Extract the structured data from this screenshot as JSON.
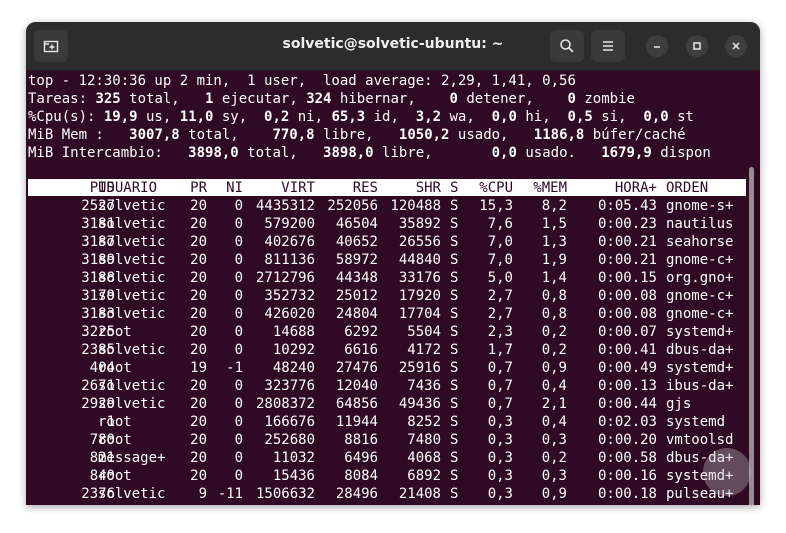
{
  "window": {
    "title": "solvetic@solvetic-ubuntu: ~",
    "icons": {
      "new_tab": "new-tab-icon",
      "search": "search-icon",
      "menu": "hamburger-menu-icon",
      "minimize": "minimize-icon",
      "maximize": "maximize-icon",
      "close": "close-icon"
    }
  },
  "summary": {
    "l1": {
      "a": "top - 12:30:36 up 2 min,  1 user,  load average: 2,29, 1,41, 0,56"
    },
    "l2": {
      "a": "Tareas: ",
      "v1": "325",
      "b": " total,   ",
      "v2": "1",
      "c": " ejecutar, ",
      "v3": "324",
      "d": " hibernar,    ",
      "v4": "0",
      "e": " detener,    ",
      "v5": "0",
      "f": " zombie"
    },
    "l3": {
      "a": "%Cpu(s): ",
      "v1": "19,9",
      "b": " us, ",
      "v2": "11,0",
      "c": " sy,  ",
      "v3": "0,2",
      "d": " ni, ",
      "v4": "65,3",
      "e": " id,  ",
      "v5": "3,2",
      "f": " wa,  ",
      "v6": "0,0",
      "g": " hi,  ",
      "v7": "0,5",
      "h": " si,  ",
      "v8": "0,0",
      "i": " st"
    },
    "l4": {
      "a": "MiB Mem :   ",
      "v1": "3007,8",
      "b": " total,    ",
      "v2": "770,8",
      "c": " libre,   ",
      "v3": "1050,2",
      "d": " usado,   ",
      "v4": "1186,8",
      "e": " búfer/caché"
    },
    "l5": {
      "a": "MiB Intercambio:   ",
      "v1": "3898,0",
      "b": " total,   ",
      "v2": "3898,0",
      "c": " libre,       ",
      "v3": "0,0",
      "d": " usado.   ",
      "v4": "1679,9",
      "e": " dispon"
    }
  },
  "columns": [
    "PID",
    "USUARIO",
    "PR",
    "NI",
    "VIRT",
    "RES",
    "SHR",
    "S",
    "%CPU",
    "%MEM",
    "HORA+",
    "ORDEN"
  ],
  "processes": [
    [
      "2527",
      "solvetic",
      "20",
      "0",
      "4435312",
      "252056",
      "120488",
      "S",
      "15,3",
      "8,2",
      "0:05.43",
      "gnome-s+"
    ],
    [
      "3181",
      "solvetic",
      "20",
      "0",
      "579200",
      "46504",
      "35892",
      "S",
      "7,6",
      "1,5",
      "0:00.23",
      "nautilus"
    ],
    [
      "3187",
      "solvetic",
      "20",
      "0",
      "402676",
      "40652",
      "26556",
      "S",
      "7,0",
      "1,3",
      "0:00.21",
      "seahorse"
    ],
    [
      "3189",
      "solvetic",
      "20",
      "0",
      "811136",
      "58972",
      "44840",
      "S",
      "7,0",
      "1,9",
      "0:00.21",
      "gnome-c+"
    ],
    [
      "3188",
      "solvetic",
      "20",
      "0",
      "2712796",
      "44348",
      "33176",
      "S",
      "5,0",
      "1,4",
      "0:00.15",
      "org.gno+"
    ],
    [
      "3179",
      "solvetic",
      "20",
      "0",
      "352732",
      "25012",
      "17920",
      "S",
      "2,7",
      "0,8",
      "0:00.08",
      "gnome-c+"
    ],
    [
      "3183",
      "solvetic",
      "20",
      "0",
      "426020",
      "24804",
      "17704",
      "S",
      "2,7",
      "0,8",
      "0:00.08",
      "gnome-c+"
    ],
    [
      "3225",
      "root",
      "20",
      "0",
      "14688",
      "6292",
      "5504",
      "S",
      "2,3",
      "0,2",
      "0:00.07",
      "systemd+"
    ],
    [
      "2385",
      "solvetic",
      "20",
      "0",
      "10292",
      "6616",
      "4172",
      "S",
      "1,7",
      "0,2",
      "0:00.41",
      "dbus-da+"
    ],
    [
      "404",
      "root",
      "19",
      "-1",
      "48240",
      "27476",
      "25916",
      "S",
      "0,7",
      "0,9",
      "0:00.49",
      "systemd+"
    ],
    [
      "2671",
      "solvetic",
      "20",
      "0",
      "323776",
      "12040",
      "7436",
      "S",
      "0,7",
      "0,4",
      "0:00.13",
      "ibus-da+"
    ],
    [
      "2929",
      "solvetic",
      "20",
      "0",
      "2808372",
      "64856",
      "49436",
      "S",
      "0,7",
      "2,1",
      "0:00.44",
      "gjs"
    ],
    [
      "1",
      "root",
      "20",
      "0",
      "166676",
      "11944",
      "8252",
      "S",
      "0,3",
      "0,4",
      "0:02.03",
      "systemd"
    ],
    [
      "780",
      "root",
      "20",
      "0",
      "252680",
      "8816",
      "7480",
      "S",
      "0,3",
      "0,3",
      "0:00.20",
      "vmtoolsd"
    ],
    [
      "821",
      "message+",
      "20",
      "0",
      "11032",
      "6496",
      "4068",
      "S",
      "0,3",
      "0,2",
      "0:00.58",
      "dbus-da+"
    ],
    [
      "840",
      "root",
      "20",
      "0",
      "15436",
      "8084",
      "6892",
      "S",
      "0,3",
      "0,3",
      "0:00.16",
      "systemd+"
    ],
    [
      "2376",
      "solvetic",
      "9",
      "-11",
      "1506632",
      "28496",
      "21408",
      "S",
      "0,3",
      "0,9",
      "0:00.18",
      "pulseau+"
    ]
  ],
  "colors": {
    "terminal_bg": "#300a24",
    "titlebar_bg": "#2c2c2c",
    "text": "#ffffff",
    "header_bg": "#ffffff"
  }
}
